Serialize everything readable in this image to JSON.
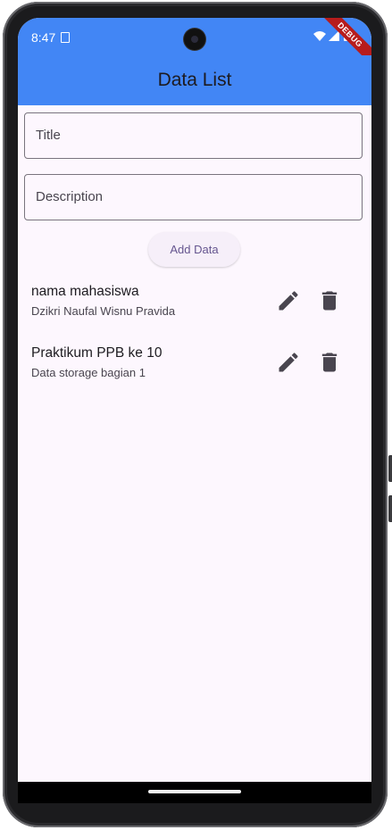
{
  "status_bar": {
    "time": "8:47",
    "debug_label": "DEBUG"
  },
  "app_bar": {
    "title": "Data List"
  },
  "form": {
    "title_label": "Title",
    "description_label": "Description",
    "add_button_label": "Add Data"
  },
  "items": [
    {
      "title": "nama mahasiswa",
      "subtitle": "Dzikri Naufal Wisnu Pravida",
      "edit_icon": "pencil-icon",
      "delete_icon": "trash-icon"
    },
    {
      "title": "Praktikum PPB ke 10",
      "subtitle": "Data storage bagian 1",
      "edit_icon": "pencil-icon",
      "delete_icon": "trash-icon"
    }
  ],
  "colors": {
    "app_bar": "#4286f5",
    "background": "#fdf7fe",
    "button_text": "#65558f",
    "icon": "#49454f",
    "debug_banner": "#b71c1c"
  }
}
